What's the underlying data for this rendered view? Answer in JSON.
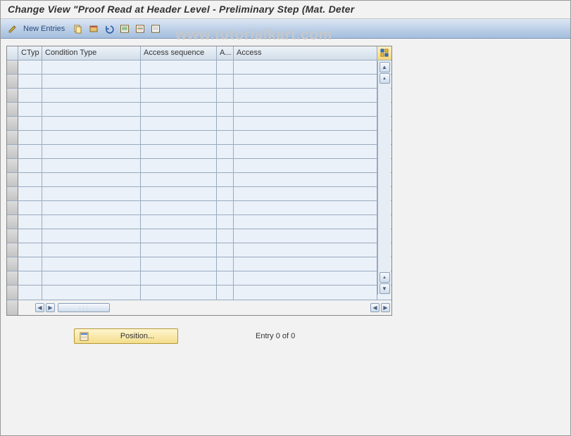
{
  "title": "Change View \"Proof Read at Header Level - Preliminary Step (Mat. Deter",
  "toolbar": {
    "new_entries_label": "New Entries"
  },
  "table": {
    "columns": {
      "ctyp": "CTyp",
      "condition_type": "Condition Type",
      "access_sequence": "Access sequence",
      "a": "A...",
      "access": "Access"
    },
    "row_count": 17
  },
  "footer": {
    "position_label": "Position...",
    "entry_text": "Entry 0 of 0"
  },
  "watermark": "www.tutorialkart.com"
}
